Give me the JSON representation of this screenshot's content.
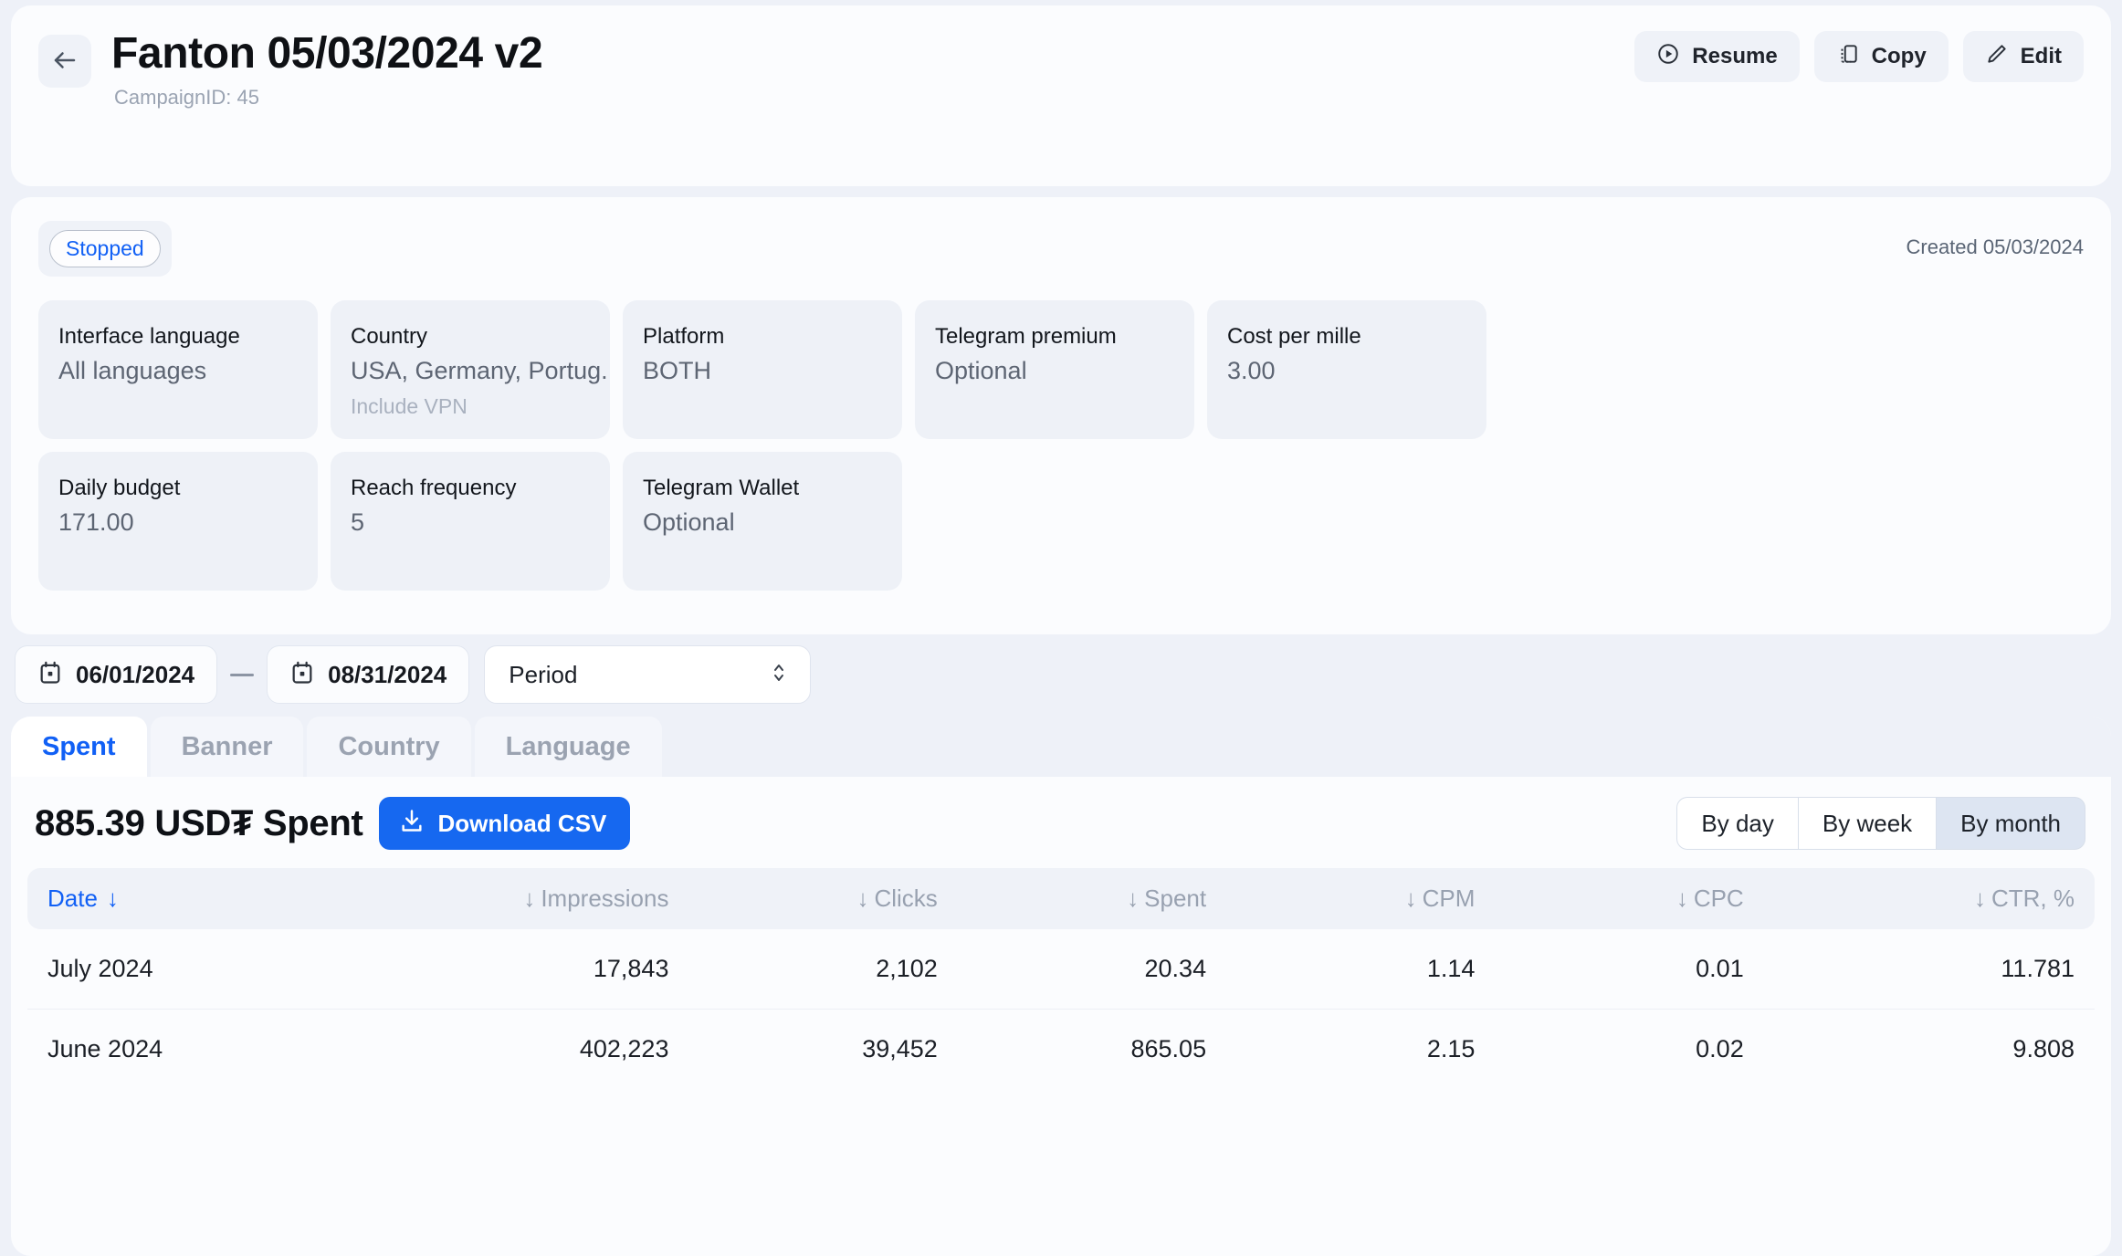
{
  "header": {
    "back_icon": "arrow-left-icon",
    "title": "Fanton 05/03/2024 v2",
    "campaign_id": "CampaignID: 45",
    "actions": [
      {
        "label": "Resume",
        "icon": "play-circle-icon"
      },
      {
        "label": "Copy",
        "icon": "copy-icon"
      },
      {
        "label": "Edit",
        "icon": "pencil-icon"
      }
    ]
  },
  "details": {
    "status": "Stopped",
    "created": "Created 05/03/2024",
    "cards_row1": [
      {
        "label": "Interface language",
        "value": "All languages",
        "sub": ""
      },
      {
        "label": "Country",
        "value": "USA, Germany, Portug...",
        "sub": "Include VPN"
      },
      {
        "label": "Platform",
        "value": "BOTH",
        "sub": ""
      },
      {
        "label": "Telegram premium",
        "value": "Optional",
        "sub": ""
      },
      {
        "label": "Cost per mille",
        "value": "3.00",
        "sub": ""
      }
    ],
    "cards_row2": [
      {
        "label": "Daily budget",
        "value": "171.00",
        "sub": ""
      },
      {
        "label": "Reach frequency",
        "value": "5",
        "sub": ""
      },
      {
        "label": "Telegram Wallet",
        "value": "Optional",
        "sub": ""
      }
    ]
  },
  "filters": {
    "date_from": "06/01/2024",
    "date_to": "08/31/2024",
    "separator": "—",
    "period_label": "Period",
    "calendar_icon": "calendar-icon",
    "stepper_icon": "chevron-up-down-icon"
  },
  "tabs": [
    {
      "label": "Spent",
      "active": true
    },
    {
      "label": "Banner",
      "active": false
    },
    {
      "label": "Country",
      "active": false
    },
    {
      "label": "Language",
      "active": false
    }
  ],
  "spent": {
    "total": "885.39 USD₮ Spent",
    "download_label": "Download CSV",
    "download_icon": "download-icon",
    "download_color": "#1668f0",
    "range_options": [
      {
        "label": "By day",
        "selected": false
      },
      {
        "label": "By week",
        "selected": false
      },
      {
        "label": "By month",
        "selected": true
      }
    ]
  },
  "table": {
    "columns": [
      {
        "label": "Date",
        "sort_icon": "arrow-down-icon",
        "icon_position": "after",
        "active": true
      },
      {
        "label": "Impressions",
        "sort_icon": "arrow-down-icon",
        "icon_position": "before",
        "active": false
      },
      {
        "label": "Clicks",
        "sort_icon": "arrow-down-icon",
        "icon_position": "before",
        "active": false
      },
      {
        "label": "Spent",
        "sort_icon": "arrow-down-icon",
        "icon_position": "before",
        "active": false
      },
      {
        "label": "CPM",
        "sort_icon": "arrow-down-icon",
        "icon_position": "before",
        "active": false
      },
      {
        "label": "CPC",
        "sort_icon": "arrow-down-icon",
        "icon_position": "before",
        "active": false
      },
      {
        "label": "CTR, %",
        "sort_icon": "arrow-down-icon",
        "icon_position": "before",
        "active": false
      }
    ],
    "rows": [
      {
        "date": "July 2024",
        "impressions": "17,843",
        "clicks": "2,102",
        "spent": "20.34",
        "cpm": "1.14",
        "cpc": "0.01",
        "ctr": "11.781"
      },
      {
        "date": "June 2024",
        "impressions": "402,223",
        "clicks": "39,452",
        "spent": "865.05",
        "cpm": "2.15",
        "cpc": "0.02",
        "ctr": "9.808"
      }
    ]
  },
  "colors": {
    "accent": "#1160f5",
    "page_bg": "#eef1f8",
    "panel_bg": "#fbfcfe",
    "card_bg": "#eef1f7"
  }
}
